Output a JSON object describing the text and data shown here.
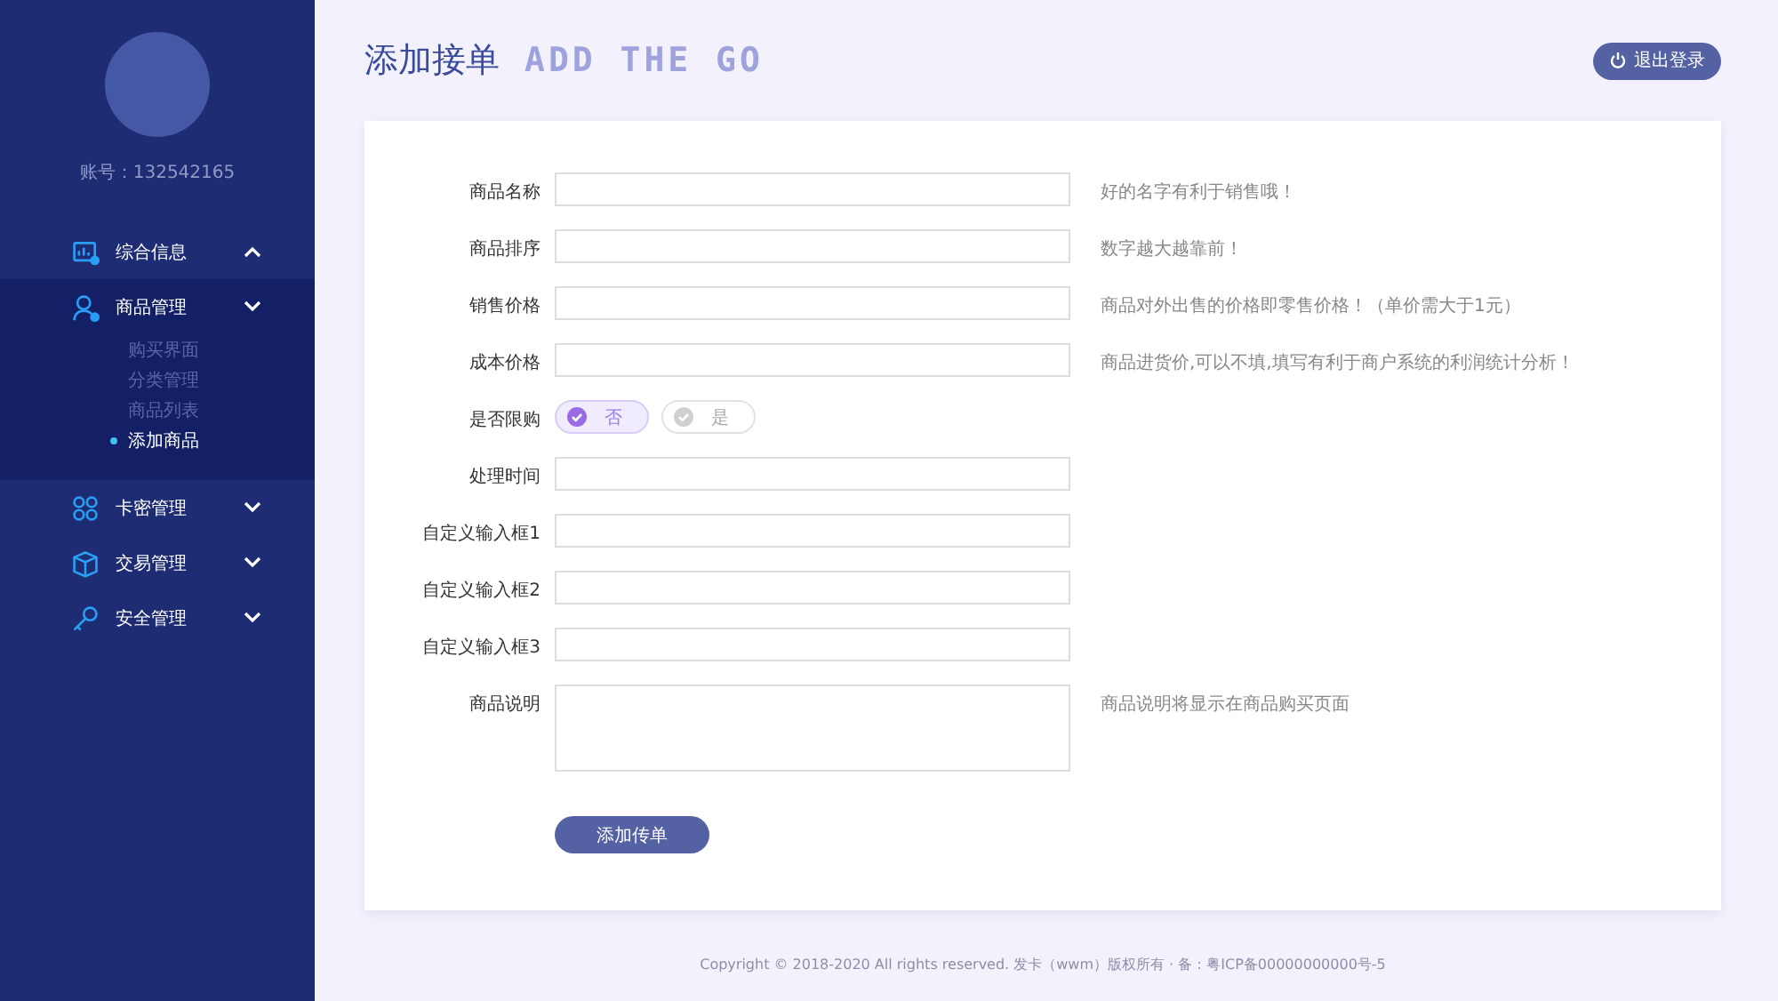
{
  "sidebar": {
    "account": "账号：132542165",
    "menu": [
      {
        "label": "综合信息",
        "arrow_up": true,
        "expanded": false
      },
      {
        "label": "商品管理",
        "arrow_up": false,
        "expanded": true,
        "children": [
          {
            "label": "购买界面",
            "selected": false
          },
          {
            "label": "分类管理",
            "selected": false
          },
          {
            "label": "商品列表",
            "selected": false
          },
          {
            "label": "添加商品",
            "selected": true
          }
        ]
      },
      {
        "label": "卡密管理",
        "arrow_up": false,
        "expanded": false
      },
      {
        "label": "交易管理",
        "arrow_up": false,
        "expanded": false
      },
      {
        "label": "安全管理",
        "arrow_up": false,
        "expanded": false
      }
    ]
  },
  "header": {
    "title": "添加接单",
    "subtitle": "ADD THE GO",
    "logout_button": "退出登录"
  },
  "form": {
    "fields": [
      {
        "kind": "text",
        "label": "商品名称",
        "hint": "好的名字有利于销售哦！"
      },
      {
        "kind": "text",
        "label": "商品排序",
        "hint": "数字越大越靠前！"
      },
      {
        "kind": "text",
        "label": "销售价格",
        "hint": "商品对外出售的价格即零售价格！（单价需大于1元）"
      },
      {
        "kind": "text",
        "label": "成本价格",
        "hint": "商品进货价,可以不填,填写有利于商户系统的利润统计分析！"
      },
      {
        "kind": "radio",
        "label": "是否限购",
        "options": [
          {
            "label": "否",
            "selected": true
          },
          {
            "label": "是",
            "selected": false
          }
        ]
      },
      {
        "kind": "text",
        "label": "处理时间"
      },
      {
        "kind": "text",
        "label": "自定义输入框1"
      },
      {
        "kind": "text",
        "label": "自定义输入框2"
      },
      {
        "kind": "text",
        "label": "自定义输入框3"
      },
      {
        "kind": "textarea",
        "label": "商品说明",
        "hint": "商品说明将显示在商品购买页面"
      }
    ],
    "submit_button": "添加传单"
  },
  "footer": "Copyright © 2018-2020 All rights reserved. 发卡（wwm）版权所有 · 备：粤ICP备00000000000号-5"
}
